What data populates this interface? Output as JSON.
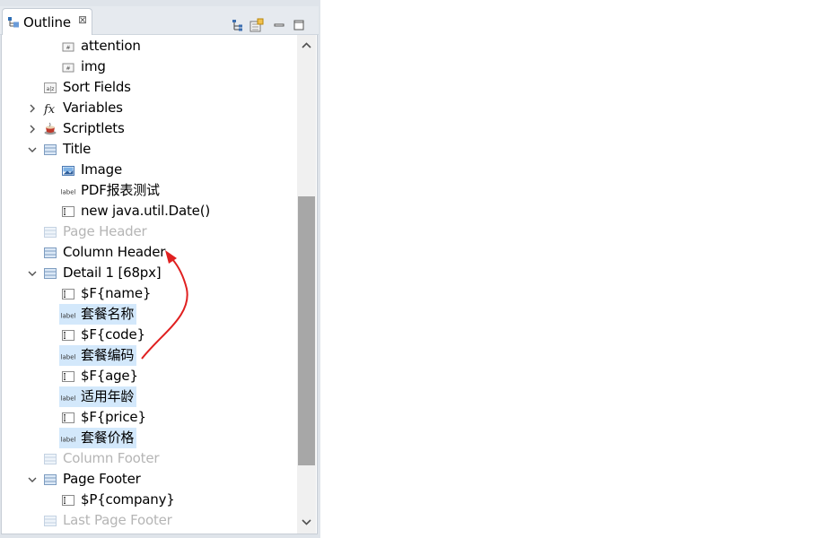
{
  "view": {
    "tab_title": "Outline",
    "close_glyph": "⊠",
    "toolbar_icons": [
      "tree-sort-icon",
      "filter-icon",
      "minimize-icon",
      "maximize-icon"
    ]
  },
  "tree": {
    "rows": [
      {
        "label": "attention",
        "icon": "field-icon",
        "twisty": "",
        "muted": false,
        "selected": false
      },
      {
        "label": "img",
        "icon": "field-icon",
        "twisty": "",
        "muted": false,
        "selected": false
      },
      {
        "label": "Sort Fields",
        "icon": "sort-icon",
        "twisty": "",
        "muted": false,
        "selected": false
      },
      {
        "label": "Variables",
        "icon": "fx-icon",
        "twisty": "collapsed",
        "muted": false,
        "selected": false
      },
      {
        "label": "Scriptlets",
        "icon": "coffee-icon",
        "twisty": "collapsed",
        "muted": false,
        "selected": false
      },
      {
        "label": "Title",
        "icon": "band-icon",
        "twisty": "expanded",
        "muted": false,
        "selected": false
      },
      {
        "label": "Image",
        "icon": "image-icon",
        "twisty": "",
        "muted": false,
        "selected": false
      },
      {
        "label": "PDF报表测试",
        "icon": "label-icon",
        "twisty": "",
        "muted": false,
        "selected": false
      },
      {
        "label": "new java.util.Date()",
        "icon": "textfield-icon",
        "twisty": "",
        "muted": false,
        "selected": false
      },
      {
        "label": "Page Header",
        "icon": "band-icon",
        "twisty": "",
        "muted": true,
        "selected": false
      },
      {
        "label": "Column Header",
        "icon": "band-icon",
        "twisty": "",
        "muted": false,
        "selected": false
      },
      {
        "label": "Detail 1 [68px]",
        "icon": "band-icon",
        "twisty": "expanded",
        "muted": false,
        "selected": false
      },
      {
        "label": "$F{name}",
        "icon": "textfield-icon",
        "twisty": "",
        "muted": false,
        "selected": false
      },
      {
        "label": "套餐名称",
        "icon": "label-icon",
        "twisty": "",
        "muted": false,
        "selected": true
      },
      {
        "label": "$F{code}",
        "icon": "textfield-icon",
        "twisty": "",
        "muted": false,
        "selected": false
      },
      {
        "label": "套餐编码",
        "icon": "label-icon",
        "twisty": "",
        "muted": false,
        "selected": true
      },
      {
        "label": "$F{age}",
        "icon": "textfield-icon",
        "twisty": "",
        "muted": false,
        "selected": false
      },
      {
        "label": "适用年龄",
        "icon": "label-icon",
        "twisty": "",
        "muted": false,
        "selected": true
      },
      {
        "label": "$F{price}",
        "icon": "textfield-icon",
        "twisty": "",
        "muted": false,
        "selected": false
      },
      {
        "label": "套餐价格",
        "icon": "label-icon",
        "twisty": "",
        "muted": false,
        "selected": true
      },
      {
        "label": "Column Footer",
        "icon": "band-icon",
        "twisty": "",
        "muted": true,
        "selected": false
      },
      {
        "label": "Page Footer",
        "icon": "band-icon",
        "twisty": "expanded",
        "muted": false,
        "selected": false
      },
      {
        "label": "$P{company}",
        "icon": "textfield-icon",
        "twisty": "",
        "muted": false,
        "selected": false
      },
      {
        "label": "Last Page Footer",
        "icon": "band-icon",
        "twisty": "",
        "muted": true,
        "selected": false
      }
    ]
  },
  "colors": {
    "selection": "#d3e8fb",
    "annotation_arrow": "#e02020",
    "muted_text": "#b5b5b5"
  }
}
